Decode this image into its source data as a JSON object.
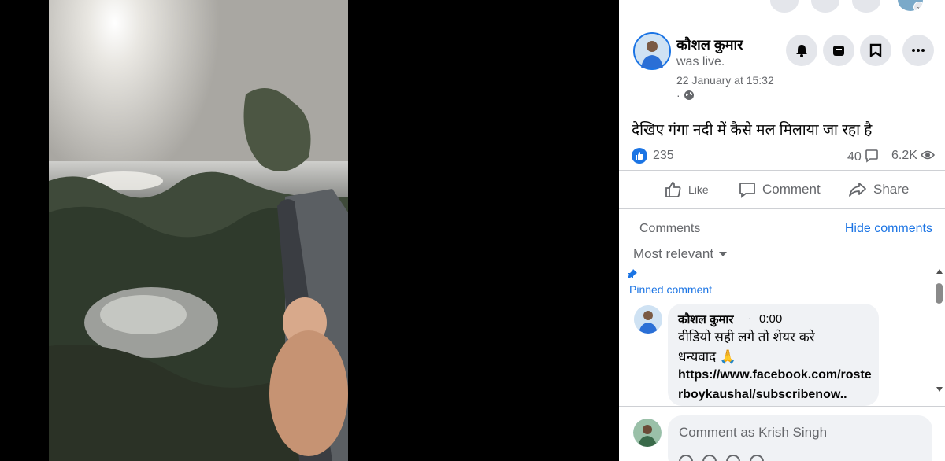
{
  "post": {
    "author": "कौशल कुमार",
    "status": "was live.",
    "timestamp": "22 January at 15:32",
    "privacy_prefix": "·",
    "privacy_icon": "globe-icon",
    "text": "देखिए गंगा नदी में कैसे मल मिलाया जा रहा है"
  },
  "stats": {
    "likes": "235",
    "comments": "40",
    "views": "6.2K"
  },
  "actions": {
    "like": "Like",
    "comment": "Comment",
    "share": "Share"
  },
  "comments_section": {
    "label": "Comments",
    "hide": "Hide comments",
    "sort": "Most relevant"
  },
  "pinned_comment": {
    "label": "Pinned comment",
    "author": "कौशल कुमार",
    "separator": "·",
    "time": "0:00",
    "line1": "वीडियो सही लगे तो शेयर करे",
    "line2": "धन्यवाद 🙏",
    "link": "https://www.facebook.com/rosterboykaushal/subscribenow.."
  },
  "composer": {
    "placeholder": "Comment as Krish Singh"
  },
  "colors": {
    "accent": "#1b74e4",
    "secondary_text": "#65676b",
    "button_bg": "#e4e6eb"
  }
}
